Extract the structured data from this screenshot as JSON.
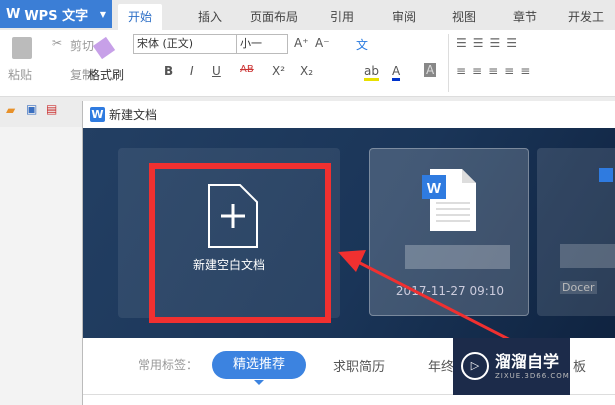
{
  "app": {
    "title": "WPS 文字",
    "dropdown_icon": "caret-down"
  },
  "tabs": [
    "开始",
    "插入",
    "页面布局",
    "引用",
    "审阅",
    "视图",
    "章节",
    "开发工具"
  ],
  "ribbon": {
    "paste": "粘贴",
    "cut": "剪切",
    "copy": "复制",
    "format_painter": "格式刷",
    "font_name": "宋体 (正文)",
    "font_size": "小一",
    "bold": "B",
    "italic": "I",
    "underline": "U",
    "strike": "AB",
    "superscript": "X²",
    "subscript": "X₂",
    "grow": "A⁺",
    "shrink": "A⁻",
    "pinyin": "文",
    "font_color": "A",
    "highlight": "ab",
    "shading": "A"
  },
  "dialog": {
    "title": "新建文档",
    "new_blank": "新建空白文档",
    "recent_date": "2017-11-27 09:10",
    "third_label": "Docer"
  },
  "tags": {
    "label": "常用标签：",
    "items": [
      "精选推荐",
      "求职简历",
      "年终",
      "板"
    ]
  },
  "watermark": {
    "name": "溜溜自学",
    "url": "ZIXUE.3D66.COM"
  },
  "colors": {
    "accent": "#3b7ed6",
    "highlight_box": "#f03030",
    "hero": "#1a3558"
  }
}
